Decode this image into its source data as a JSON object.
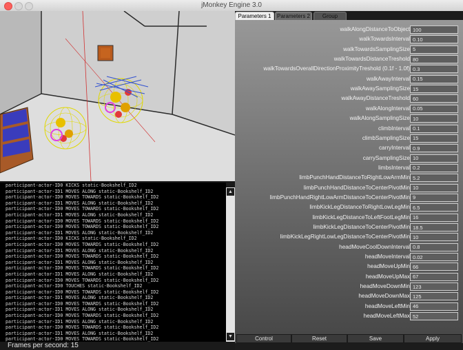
{
  "window": {
    "title": "jMonkey Engine 3.0"
  },
  "tabs": [
    "Parameters 1",
    "Parameters 2",
    "Group"
  ],
  "params": [
    {
      "name": "walkAlongDistanceToObject",
      "value": "100"
    },
    {
      "name": "walkTowardsInterval",
      "value": "0.10"
    },
    {
      "name": "walkTowardsSamplingSize",
      "value": "5"
    },
    {
      "name": "walkTowardsDistanceTreshold",
      "value": "80"
    },
    {
      "name": "walkTowardsOverallDirectionProximityTreshold (0.1f - 1.0f)",
      "value": "0.3"
    },
    {
      "name": "walkAwayInterval",
      "value": "0.15"
    },
    {
      "name": "walkAwaySamplingSize",
      "value": "15"
    },
    {
      "name": "walkAwayDistanceTreshold",
      "value": "60"
    },
    {
      "name": "walkAlongInterval",
      "value": "0.05"
    },
    {
      "name": "walkAlongSamplingSize",
      "value": "10"
    },
    {
      "name": "climbInterval",
      "value": "0.1"
    },
    {
      "name": "climbSamplingSize",
      "value": "15"
    },
    {
      "name": "carryInterval",
      "value": "0.9"
    },
    {
      "name": "carrySamplingSize",
      "value": "10"
    },
    {
      "name": "limbsInterval",
      "value": "0.2"
    },
    {
      "name": "limbPunchHandDistanceToRightLowArmMin",
      "value": "5.2"
    },
    {
      "name": "limbPunchHandDistanceToCenterPivotMin",
      "value": "10"
    },
    {
      "name": "limbPunchHandRightLowArmDistanceToCenterPivotMin",
      "value": "9"
    },
    {
      "name": "limbKickLegDistanceToRightLowLegMin",
      "value": "6.5"
    },
    {
      "name": "limbKickLegDistanceToLeftFootLegMin",
      "value": "16"
    },
    {
      "name": "limbKickLegDistanceToCenterPivotMin",
      "value": "18.5"
    },
    {
      "name": "limbKickLegRightLowLegDistanceToCenterPivotMin",
      "value": "10"
    },
    {
      "name": "headMoveCoolDownInterval",
      "value": "0.8"
    },
    {
      "name": "headMoveInterval",
      "value": "0.02"
    },
    {
      "name": "headMoveUpMin",
      "value": "66"
    },
    {
      "name": "headMoveUpMax",
      "value": "67"
    },
    {
      "name": "headMoveDownMin",
      "value": "123"
    },
    {
      "name": "headMoveDownMax",
      "value": "125"
    },
    {
      "name": "headMoveLeftMin",
      "value": "46"
    },
    {
      "name": "headMoveLeftMax",
      "value": "52"
    }
  ],
  "buttons": {
    "control": "Control",
    "reset": "Reset",
    "save": "Save",
    "apply": "Apply"
  },
  "log": [
    "participant-actor-ID0 KICKS static-Bookshelf_ID2",
    "participant-actor-ID1 MOVES ALONG static-Bookshelf_ID2",
    "participant-actor-ID0 MOVES TOWARDS static-Bookshelf_ID2",
    "participant-actor-ID1 MOVES ALONG static-Bookshelf_ID2",
    "participant-actor-ID0 MOVES TOWARDS static-Bookshelf_ID2",
    "participant-actor-ID1 MOVES ALONG static-Bookshelf_ID2",
    "participant-actor-ID0 MOVES TOWARDS static-Bookshelf_ID2",
    "participant-actor-ID0 MOVES TOWARDS static-Bookshelf_ID2",
    "participant-actor-ID1 MOVES ALONG static-Bookshelf_ID2",
    "participant-actor-ID0 KICKS static-Bookshelf_ID2",
    "participant-actor-ID0 MOVES TOWARDS static-Bookshelf_ID2",
    "participant-actor-ID1 MOVES ALONG static-Bookshelf_ID2",
    "participant-actor-ID0 MOVES TOWARDS static-Bookshelf_ID2",
    "participant-actor-ID1 MOVES ALONG static-Bookshelf_ID2",
    "participant-actor-ID0 MOVES TOWARDS static-Bookshelf_ID2",
    "participant-actor-ID1 MOVES ALONG static-Bookshelf_ID2",
    "participant-actor-ID0 MOVES TOWARDS static-Bookshelf_ID2",
    "participant-actor-ID0 TOUCHES static-Bookshelf_ID2",
    "participant-actor-ID0 MOVES TOWARDS static-Bookshelf_ID2",
    "participant-actor-ID1 MOVES ALONG static-Bookshelf_ID2",
    "participant-actor-ID0 MOVES TOWARDS static-Bookshelf_ID2",
    "participant-actor-ID1 MOVES ALONG static-Bookshelf_ID2",
    "participant-actor-ID0 MOVES TOWARDS static-Bookshelf_ID2",
    "participant-actor-ID1 MOVES ALONG static-Bookshelf_ID2",
    "participant-actor-ID0 MOVES TOWARDS static-Bookshelf_ID2",
    "participant-actor-ID1 MOVES ALONG static-Bookshelf_ID2",
    "participant-actor-ID0 MOVES TOWARDS static-Bookshelf_ID2"
  ],
  "status": {
    "fps": "Frames per second: 15"
  }
}
